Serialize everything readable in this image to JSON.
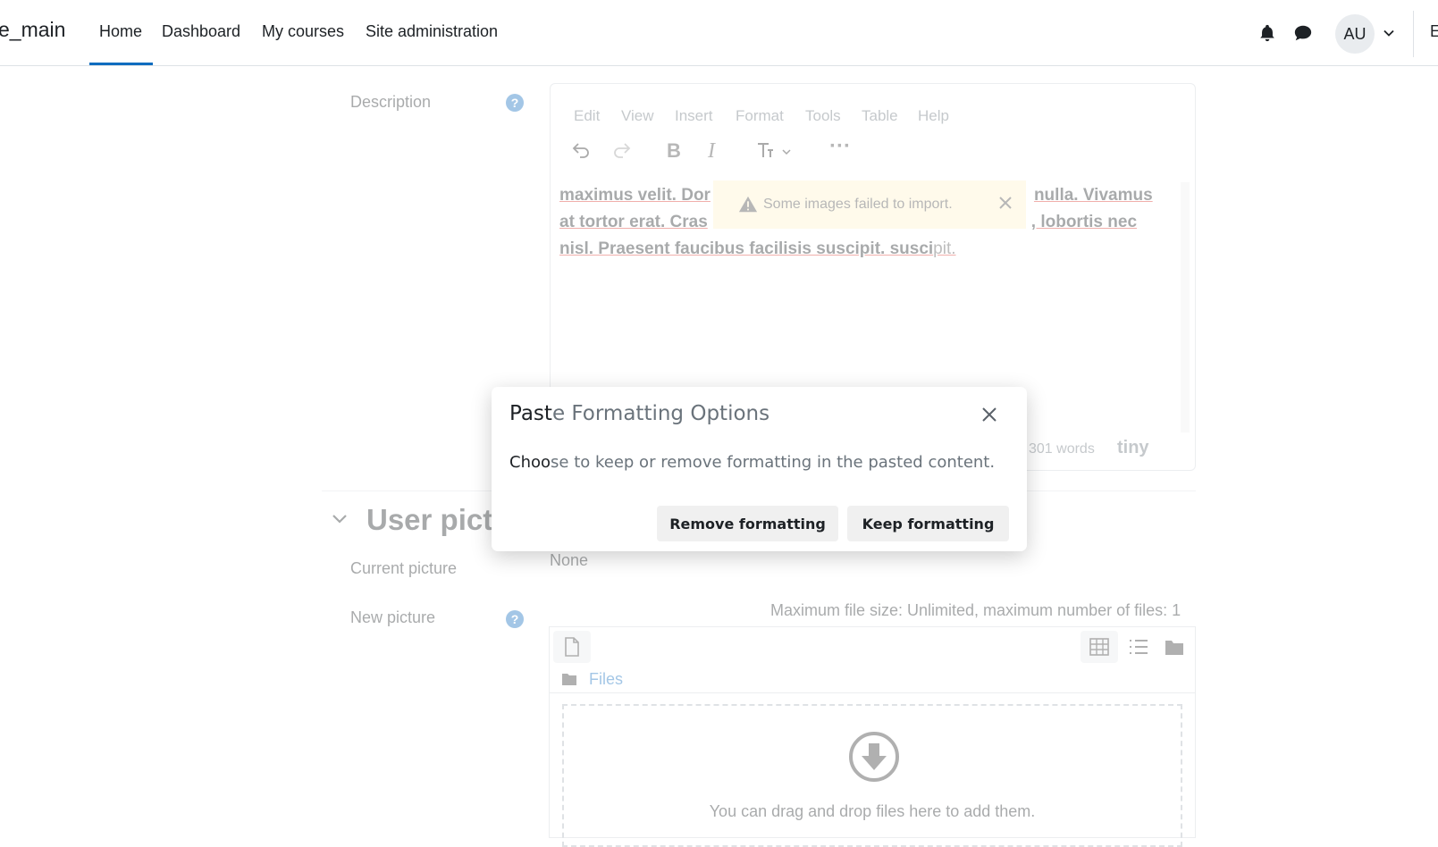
{
  "navbar": {
    "brand": "e_main",
    "items": [
      {
        "label": "Home",
        "active": true
      },
      {
        "label": "Dashboard"
      },
      {
        "label": "My courses"
      },
      {
        "label": "Site administration"
      }
    ],
    "avatar_initials": "AU",
    "trailing_text": "E",
    "icons": [
      "bell-icon",
      "chat-icon",
      "chevron-down-icon"
    ]
  },
  "form": {
    "description_label": "Description",
    "editor": {
      "menubar": [
        "Edit",
        "View",
        "Insert",
        "Format",
        "Tools",
        "Table",
        "Help"
      ],
      "toolbar_icons": [
        "undo-icon",
        "redo-icon",
        "bold-icon",
        "italic-icon",
        "text-format-icon",
        "more-icon"
      ],
      "content": {
        "line1_a": "maximus velit. Dor",
        "line1_b": "nulla. Vivamus",
        "line2_a": "at tortor erat. Cras",
        "line2_b": ", lobortis nec",
        "line3_a": "nisl. Praesent faucibus facilisis suscipit. susci",
        "line3_b": "pit."
      },
      "warning": "Some images failed to import.",
      "word_count": "301 words",
      "brand": "tiny"
    },
    "user_picture_section": "User pict",
    "current_picture_label": "Current picture",
    "current_picture_value": "None",
    "new_picture_label": "New picture",
    "max_file_size": "Maximum file size: Unlimited, maximum number of files: 1",
    "files_label": "Files",
    "drop_text": "You can drag and drop files here to add them."
  },
  "modal": {
    "title_strong": "Past",
    "title_rest": "e Formatting Options",
    "body_strong": "Choo",
    "body_rest": "se to keep or remove formatting in the pasted content.",
    "remove_label": "Remove formatting",
    "keep_label": "Keep formatting"
  },
  "colors": {
    "accent": "#0f6cbf",
    "warning_bg": "#fff3cd"
  }
}
